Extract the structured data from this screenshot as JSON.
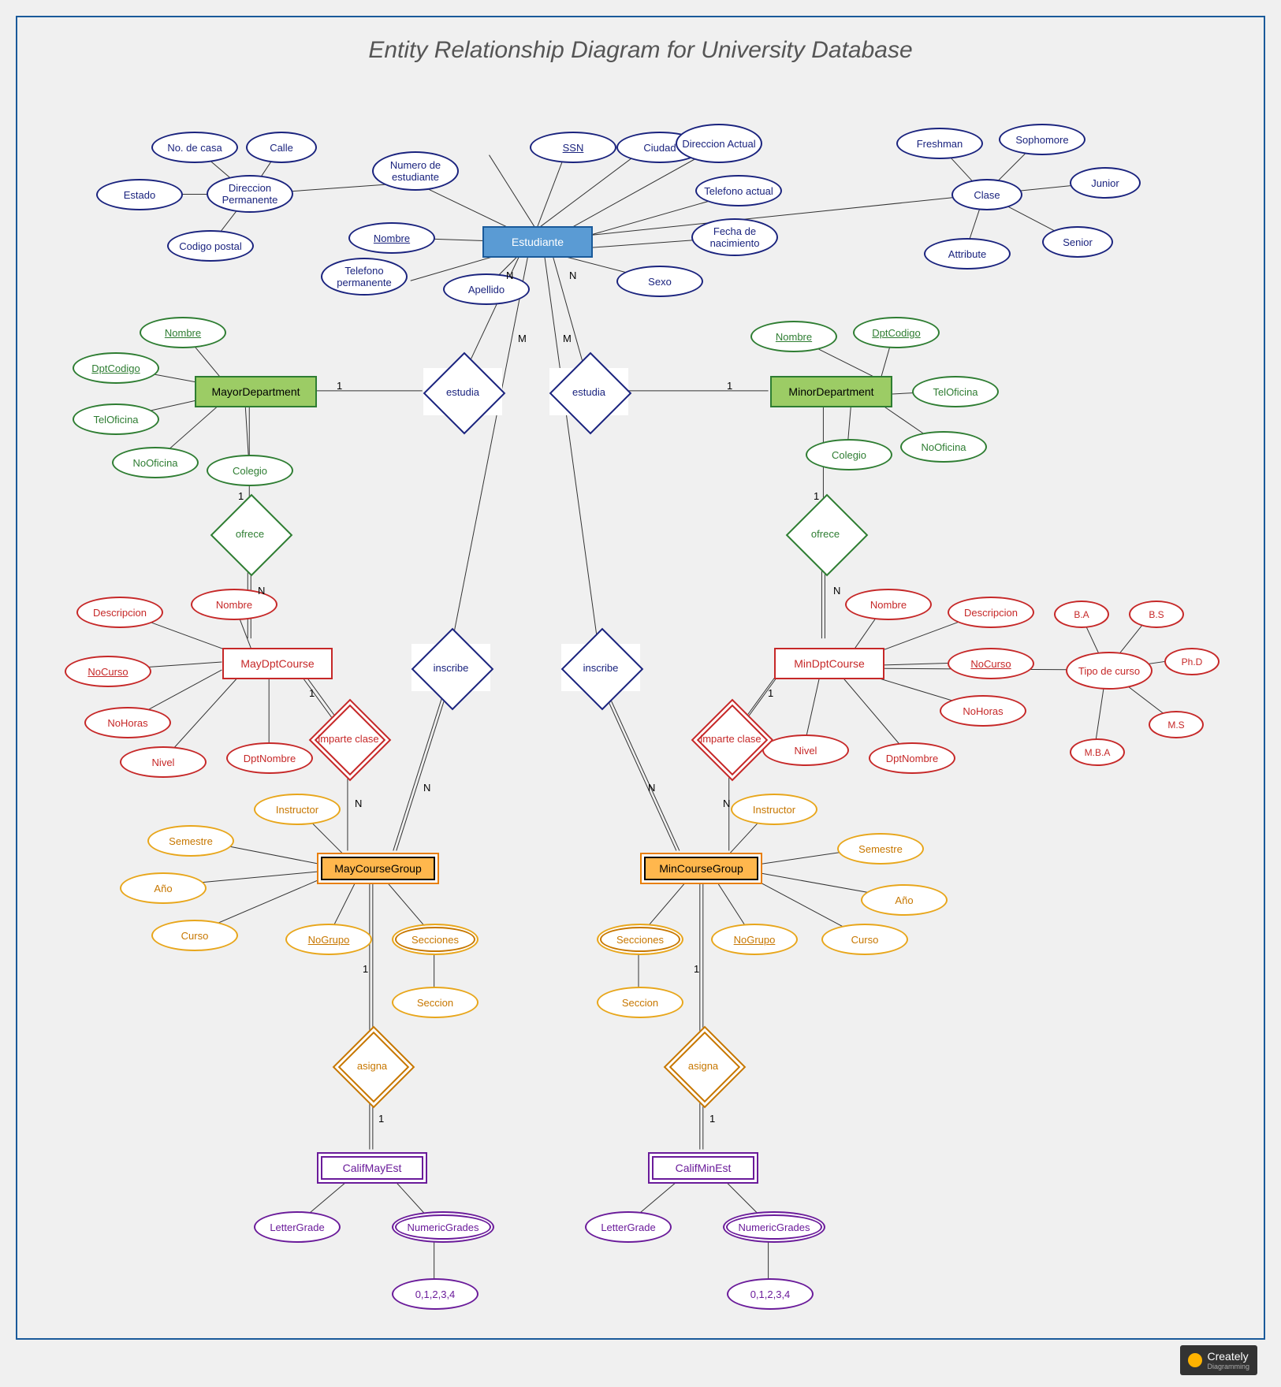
{
  "title": "Entity Relationship Diagram for University Database",
  "logo": {
    "main": "Creately",
    "sub": "Diagramming"
  },
  "entities": {
    "estudiante": "Estudiante",
    "mayorDept": "MayorDepartment",
    "minorDept": "MinorDepartment",
    "mayDptCourse": "MayDptCourse",
    "minDptCourse": "MinDptCourse",
    "mayCourseGroup": "MayCourseGroup",
    "minCourseGroup": "MinCourseGroup",
    "califMayEst": "CalifMayEst",
    "califMinEst": "CalifMinEst"
  },
  "relationships": {
    "estudia1": "estudia",
    "estudia2": "estudia",
    "ofrece1": "ofrece",
    "ofrece2": "ofrece",
    "inscribe1": "inscribe",
    "inscribe2": "inscribe",
    "imparte1": "imparte clase",
    "imparte2": "imparte clase",
    "asigna1": "asigna",
    "asigna2": "asigna"
  },
  "attrs": {
    "estudiante": {
      "ssn": "SSN",
      "ciudad": "Ciudad",
      "dirActual": "Direccion Actual",
      "telActual": "Telefono actual",
      "fechaNac": "Fecha de nacimiento",
      "sexo": "Sexo",
      "apellido": "Apellido",
      "nombre": "Nombre",
      "numEst": "Numero de estudiante",
      "telPerm": "Telefono permanente",
      "dirPerm": "Direccion Permanente",
      "noCasa": "No. de casa",
      "calle": "Calle",
      "estado": "Estado",
      "codPostal": "Codigo postal",
      "clase": "Clase",
      "freshman": "Freshman",
      "sophomore": "Sophomore",
      "junior": "Junior",
      "senior": "Senior",
      "attribute": "Attribute"
    },
    "dept": {
      "nombre": "Nombre",
      "dptCodigo": "DptCodigo",
      "telOficina": "TelOficina",
      "noOficina": "NoOficina",
      "colegio": "Colegio"
    },
    "course": {
      "nombre": "Nombre",
      "descripcion": "Descripcion",
      "noCurso": "NoCurso",
      "noHoras": "NoHoras",
      "nivel": "Nivel",
      "dptNombre": "DptNombre",
      "tipoCurso": "Tipo de curso",
      "ba": "B.A",
      "bs": "B.S",
      "phd": "Ph.D",
      "ms": "M.S",
      "mba": "M.B.A"
    },
    "group": {
      "instructor": "Instructor",
      "semestre": "Semestre",
      "ano": "Año",
      "curso": "Curso",
      "noGrupo": "NoGrupo",
      "secciones": "Secciones",
      "seccion": "Seccion"
    },
    "calif": {
      "letterGrade": "LetterGrade",
      "numericGrades": "NumericGrades",
      "values": "0,1,2,3,4"
    }
  },
  "card": {
    "N": "N",
    "M": "M",
    "one": "1"
  }
}
